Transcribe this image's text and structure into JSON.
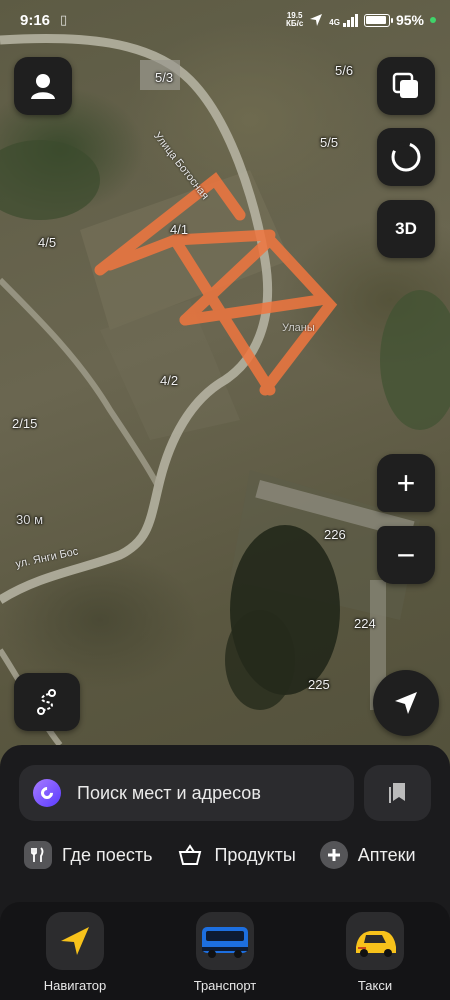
{
  "status_bar": {
    "time": "9:16",
    "speed_value": "19.5",
    "speed_unit": "КБ/с",
    "network": "4G",
    "battery_percent": "95%",
    "battery_level": 0.95
  },
  "map": {
    "house_numbers": [
      "5/3",
      "5/6",
      "5/5",
      "4/1",
      "4/5",
      "4/2",
      "2/15",
      "226",
      "224",
      "225"
    ],
    "street_labels": [
      "Улица Ботосная",
      "ул. Янги Бос",
      "Уланы"
    ],
    "scale_label": "30 м",
    "route_color": "#f0763f"
  },
  "controls": {
    "layers_icon": "layers-icon",
    "compass_icon": "compass-icon",
    "button_3d": "3D",
    "zoom_in": "+",
    "zoom_out": "−",
    "location_icon": "navigation-arrow-icon",
    "profile_icon": "user-icon",
    "route_icon": "route-icon"
  },
  "search": {
    "placeholder": "Поиск мест и адресов"
  },
  "categories": [
    {
      "label": "Где поесть",
      "icon": "fork-knife-icon"
    },
    {
      "label": "Продукты",
      "icon": "basket-icon"
    },
    {
      "label": "Аптеки",
      "icon": "pharmacy-cross-icon"
    }
  ],
  "tabs": [
    {
      "label": "Навигатор",
      "icon": "navigator-icon"
    },
    {
      "label": "Транспорт",
      "icon": "bus-icon"
    },
    {
      "label": "Такси",
      "icon": "taxi-icon"
    }
  ],
  "colors": {
    "sheet_bg": "#1b1b1d",
    "button_bg": "#1f1f1f",
    "accent_purple": "#7a4dff",
    "taxi_yellow": "#f7c21b",
    "bus_blue": "#1d6fe0"
  }
}
